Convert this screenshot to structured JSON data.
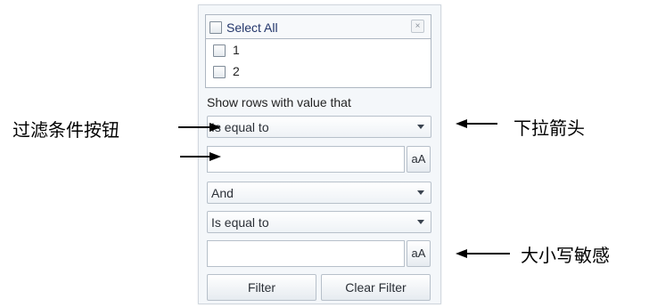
{
  "filter_panel": {
    "select_all_label": "Select All",
    "close_glyph": "×",
    "items": [
      {
        "label": "1"
      },
      {
        "label": "2"
      }
    ],
    "show_rows_label": "Show rows with value that",
    "condition1": {
      "operator": "Is equal to",
      "value": "",
      "case_button": "aA"
    },
    "logic_operator": "And",
    "condition2": {
      "operator": "Is equal to",
      "value": "",
      "case_button": "aA"
    },
    "buttons": {
      "filter": "Filter",
      "clear_filter": "Clear Filter"
    }
  },
  "annotations": {
    "filter_condition_button": "过滤条件按钮",
    "dropdown_arrow": "下拉箭头",
    "case_sensitive": "大小写敏感"
  },
  "icons": {
    "dropdown_arrow": "chevron-down-icon",
    "close": "close-icon",
    "annotation_arrow": "arrow-icon"
  }
}
